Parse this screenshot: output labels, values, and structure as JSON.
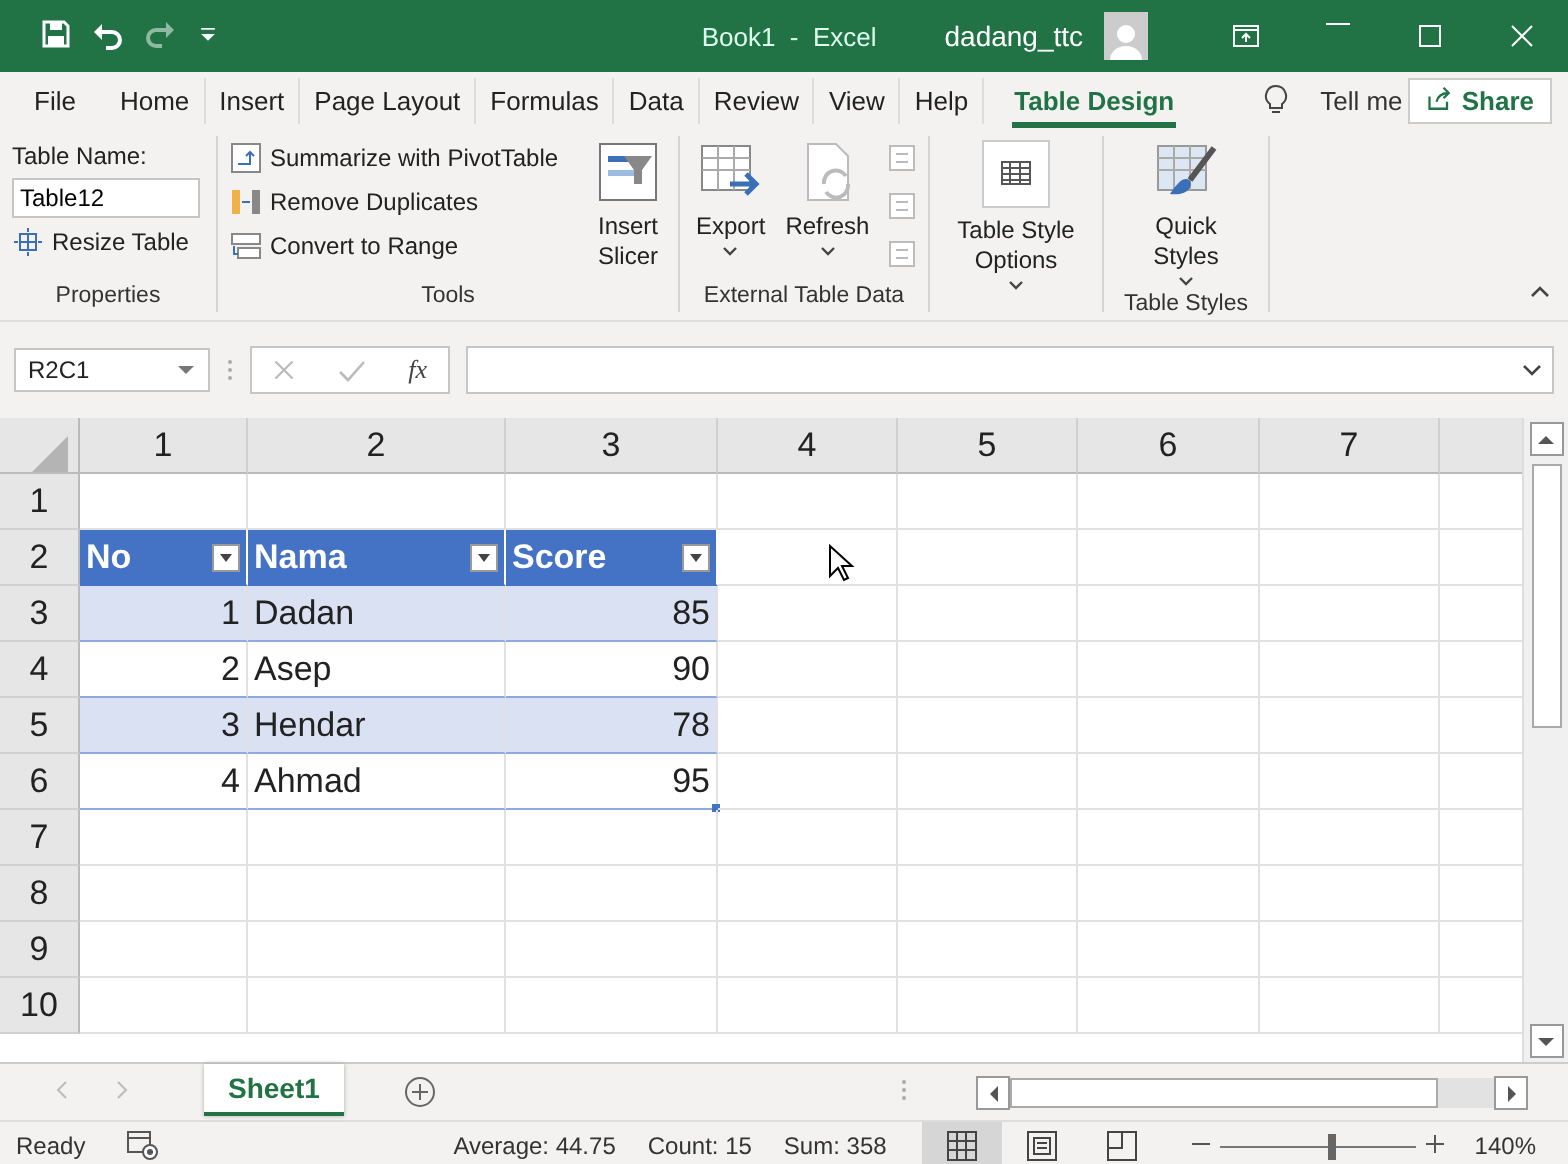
{
  "title_bar": {
    "title": "Book1  -  Excel",
    "user": "dadang_ttc"
  },
  "menu_tabs": [
    {
      "label": "File",
      "selected": false
    },
    {
      "label": "Home",
      "selected": false
    },
    {
      "label": "Insert",
      "selected": false
    },
    {
      "label": "Page Layout",
      "selected": false
    },
    {
      "label": "Formulas",
      "selected": false
    },
    {
      "label": "Data",
      "selected": false
    },
    {
      "label": "Review",
      "selected": false
    },
    {
      "label": "View",
      "selected": false
    },
    {
      "label": "Help",
      "selected": false
    },
    {
      "label": "Table Design",
      "selected": true
    }
  ],
  "tell_me": "Tell me",
  "share": "Share",
  "ribbon": {
    "properties": {
      "name_label": "Table Name:",
      "name_value": "Table12",
      "resize": "Resize Table",
      "group": "Properties"
    },
    "tools": {
      "items": [
        "Summarize with PivotTable",
        "Remove Duplicates",
        "Convert to Range"
      ],
      "slicer": "Insert Slicer",
      "group": "Tools"
    },
    "external": {
      "export": "Export",
      "refresh": "Refresh",
      "group": "External Table Data"
    },
    "style_options": {
      "label": "Table Style Options"
    },
    "table_styles": {
      "quick": "Quick Styles",
      "group": "Table Styles"
    }
  },
  "formula_bar": {
    "name_box": "R2C1",
    "fx": "fx"
  },
  "sheet": {
    "column_headers": [
      "1",
      "2",
      "3",
      "4",
      "5",
      "6",
      "7"
    ],
    "row_headers": [
      "1",
      "2",
      "3",
      "4",
      "5",
      "6",
      "7",
      "8",
      "9",
      "10"
    ]
  },
  "table": {
    "columns": [
      {
        "name": "No",
        "kind": "number"
      },
      {
        "name": "Nama",
        "kind": "text"
      },
      {
        "name": "Score",
        "kind": "number"
      }
    ],
    "rows": [
      {
        "cells": [
          "1",
          "Dadan",
          "85"
        ],
        "banded": true
      },
      {
        "cells": [
          "2",
          "Asep",
          "90"
        ],
        "banded": false
      },
      {
        "cells": [
          "3",
          "Hendar",
          "78"
        ],
        "banded": true
      },
      {
        "cells": [
          "4",
          "Ahmad",
          "95"
        ],
        "banded": false
      }
    ]
  },
  "sheet_tabs": [
    {
      "label": "Sheet1",
      "selected": true
    }
  ],
  "status_bar": {
    "mode": "Ready",
    "average": "Average: 44.75",
    "count": "Count: 15",
    "sum": "Sum: 358",
    "views": [
      {
        "kind": "normal",
        "selected": true
      },
      {
        "kind": "page-layout",
        "selected": false
      },
      {
        "kind": "page-break",
        "selected": false
      }
    ],
    "zoom": {
      "level": 0.57,
      "reading": "140%"
    }
  }
}
